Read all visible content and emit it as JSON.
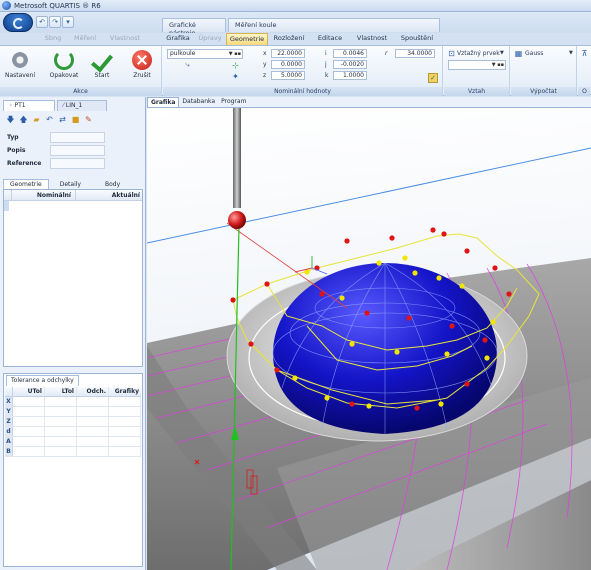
{
  "window": {
    "title": "Metrosoft QUARTIS ® R6"
  },
  "quick_access": {
    "undo": "↶",
    "redo": "↷"
  },
  "context_tabs": [
    "Grafické nástroje",
    "Měření koule"
  ],
  "ribbon_tabs": [
    {
      "label": "Sbng",
      "state": "dim"
    },
    {
      "label": "Měření",
      "state": "dim"
    },
    {
      "label": "Vlastnost",
      "state": "dim"
    },
    {
      "label": "Grafika",
      "state": "normal"
    },
    {
      "label": "Úpravy",
      "state": "dim"
    },
    {
      "label": "Geometrie",
      "state": "active"
    },
    {
      "label": "Rozložení",
      "state": "normal"
    },
    {
      "label": "Editace",
      "state": "normal"
    },
    {
      "label": "Vlastnost",
      "state": "normal"
    },
    {
      "label": "Spouštění",
      "state": "normal"
    }
  ],
  "ribbon": {
    "akce": {
      "label": "Akce",
      "settings": "Nastavení",
      "repeat": "Opakovat",
      "start": "Start",
      "cancel": "Zrušit"
    },
    "nominal": {
      "label": "Nominální hodnoty",
      "feature_combo": "pulkoule",
      "x_label": "x",
      "x": "22.0000",
      "y_label": "y",
      "y": "0.0000",
      "z_label": "z",
      "z": "5.0000",
      "i_label": "i",
      "i": "0.0046",
      "j_label": "j",
      "j": "-0.0020",
      "k_label": "k",
      "k": "1.0000",
      "diameter_label": "r",
      "diameter": "34.0000"
    },
    "vztah": {
      "label": "Vztah",
      "combo": "Vztažný prvek"
    },
    "vypocet": {
      "label": "Výpočtat",
      "combo": "Gauss"
    },
    "extra": {
      "label": "O"
    }
  },
  "left_panel": {
    "tabs": [
      "PT1",
      "LIN_1"
    ],
    "fields": {
      "type_label": "Typ",
      "description_label": "Popis",
      "reference_label": "Reference"
    },
    "subtabs": [
      "Geometrie",
      "Detaily",
      "Body"
    ],
    "geometry_grid": {
      "col_nominal": "Nominální",
      "col_actual": "Aktuální"
    },
    "tolerance": {
      "tab": "Tolerance a odchylky",
      "columns": [
        "UTol",
        "LTol",
        "Odch.",
        "Grafiky"
      ],
      "rows": [
        "X",
        "Y",
        "Z",
        "d",
        "A",
        "B"
      ]
    }
  },
  "viewport": {
    "tabs": [
      "Grafika",
      "Databanka",
      "Program"
    ],
    "colors": {
      "sphere": "#1a1ad6",
      "plate": "#8c8c8c",
      "probe": "#d21e1e",
      "path": "#e8e43a"
    }
  }
}
